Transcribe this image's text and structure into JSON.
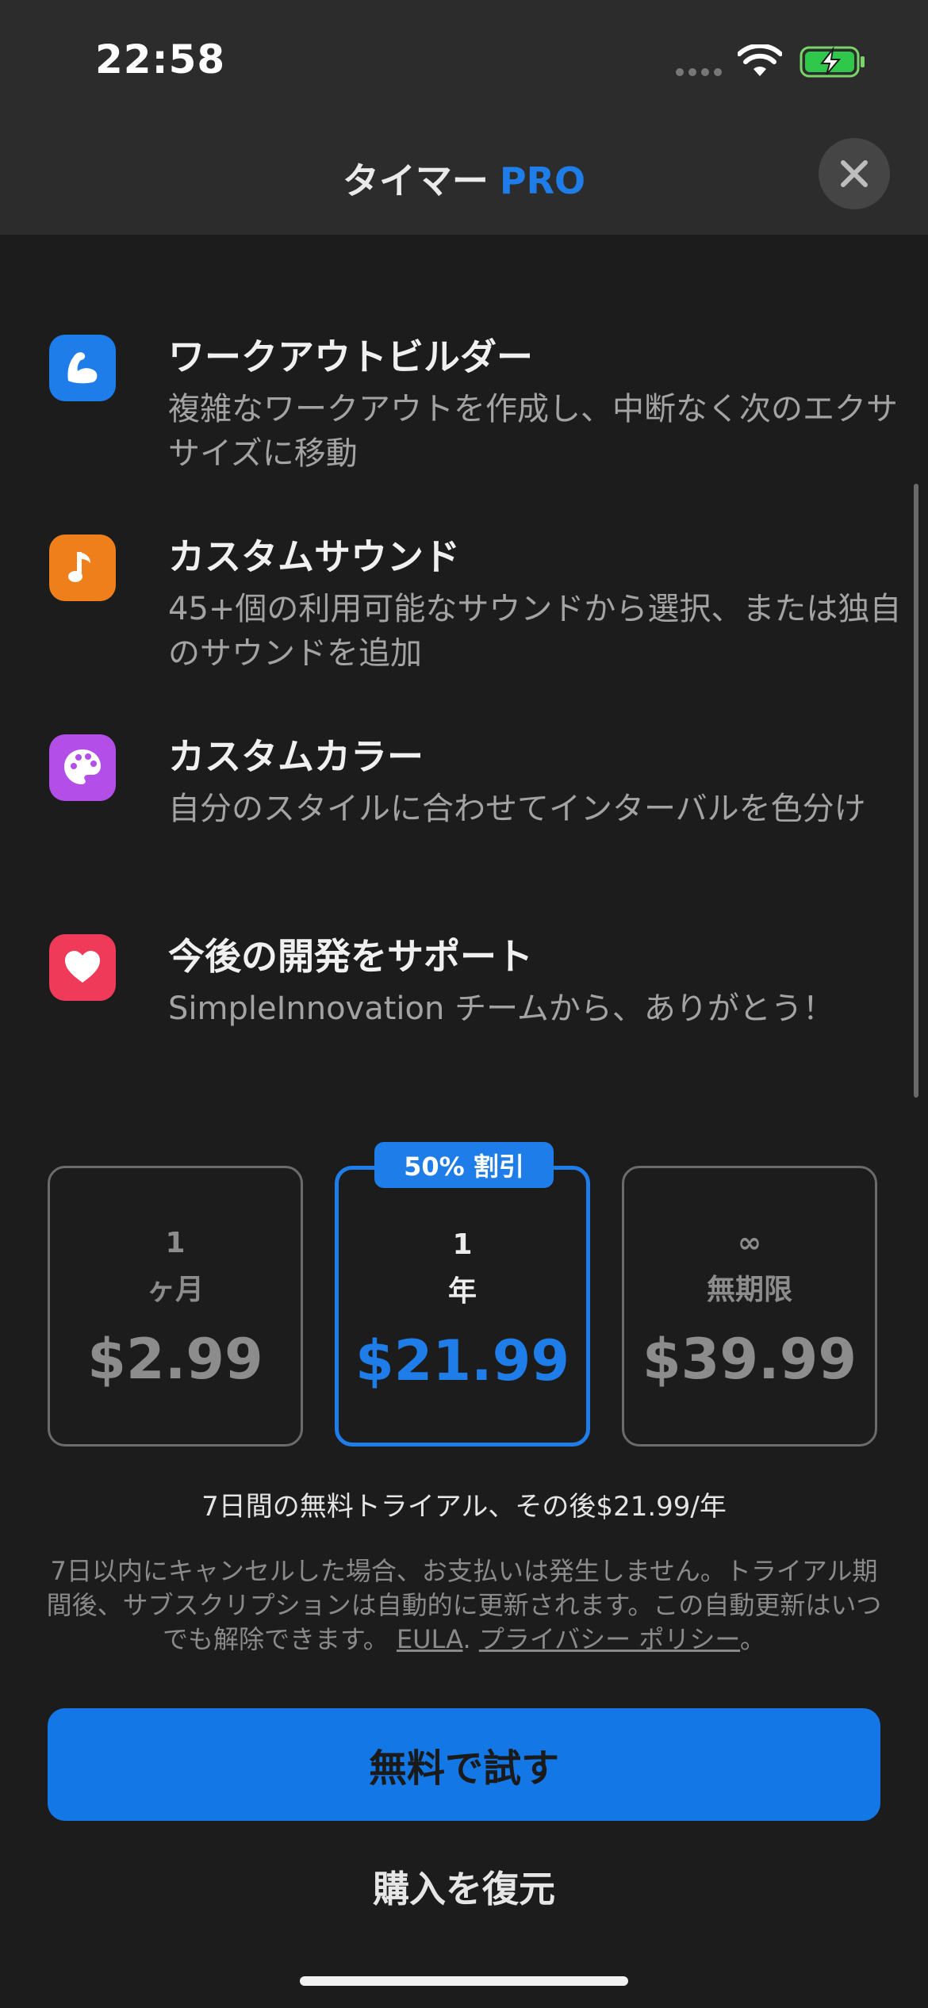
{
  "status_bar": {
    "time": "22:58"
  },
  "header": {
    "title": "タイマー",
    "pro": "PRO"
  },
  "features": [
    {
      "title": "ワークアウトビルダー",
      "description": "複雑なワークアウトを作成し、中断なく次のエクササイズに移動",
      "icon": "flexed-arm-icon",
      "color": "#1e7de8"
    },
    {
      "title": "カスタムサウンド",
      "description": "45+個の利用可能なサウンドから選択、または独自のサウンドを追加",
      "icon": "music-note-icon",
      "color": "#ef7f1a"
    },
    {
      "title": "カスタムカラー",
      "description": "自分のスタイルに合わせてインターバルを色分け",
      "icon": "palette-icon",
      "color": "#b34ee8"
    },
    {
      "title": "今後の開発をサポート",
      "description": "SimpleInnovation チームから、ありがとう！",
      "icon": "heart-icon",
      "color": "#f03a5a"
    }
  ],
  "plans": [
    {
      "top": "1",
      "bottom": "ヶ月",
      "price": "$2.99",
      "selected": false
    },
    {
      "top": "1",
      "bottom": "年",
      "price": "$21.99",
      "selected": true,
      "badge": "50% 割引"
    },
    {
      "top": "∞",
      "bottom": "無期限",
      "price": "$39.99",
      "selected": false
    }
  ],
  "trial_text": "7日間の無料トライアル、その後$21.99/年",
  "fine_print": {
    "text": "7日以内にキャンセルした場合、お支払いは発生しません。トライアル期間後、サブスクリプションは自動的に更新されます。この自動更新はいつでも解除できます。",
    "eula": "EULA",
    "separator": ".",
    "privacy": "プライバシー ポリシー",
    "end": "。"
  },
  "buttons": {
    "try_free": "無料で試す",
    "restore": "購入を復元"
  },
  "colors": {
    "accent": "#1e7de8",
    "background": "#1c1c1c",
    "bar": "#2c2c2c"
  }
}
